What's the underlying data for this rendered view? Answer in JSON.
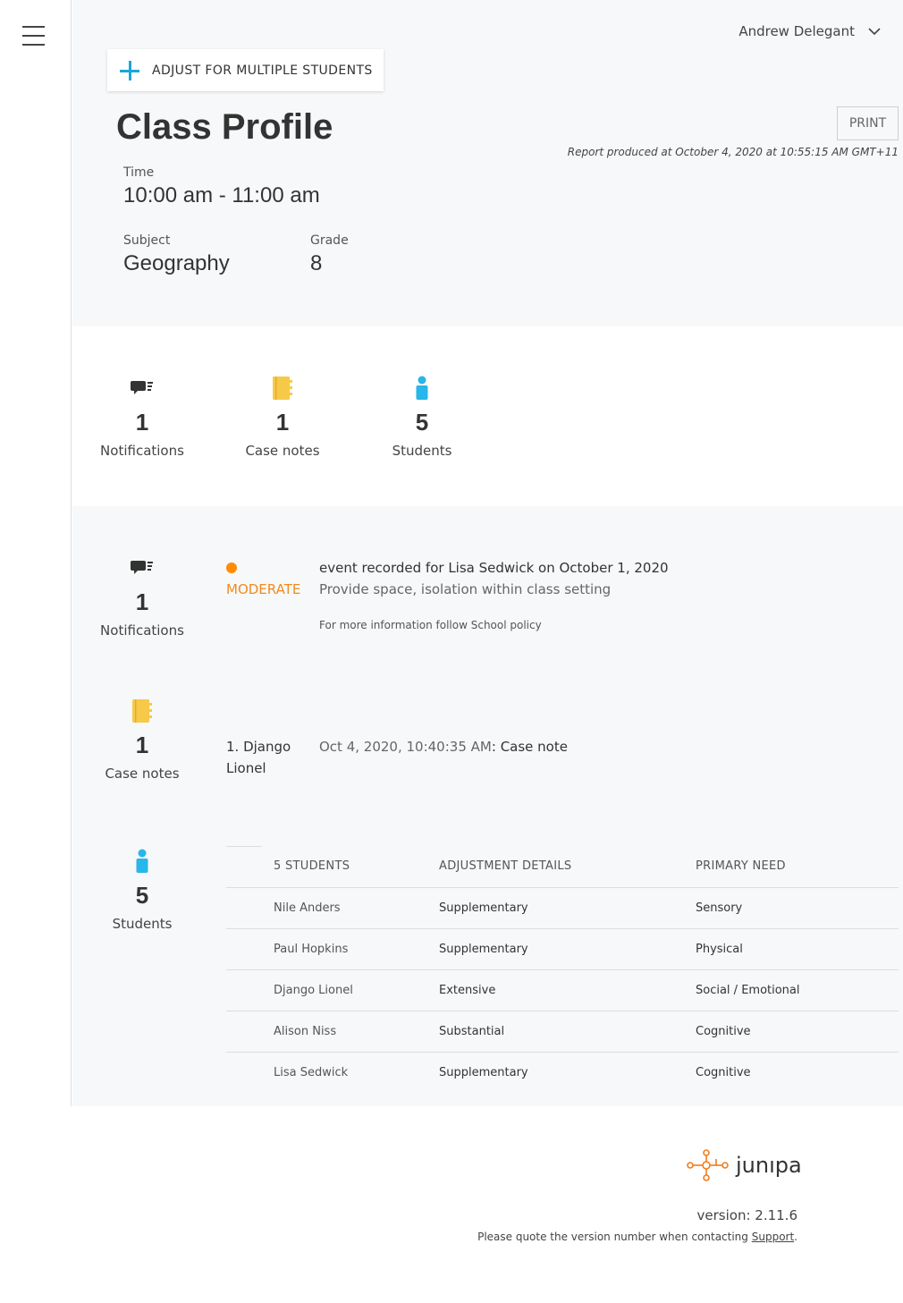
{
  "user": {
    "name": "Andrew Delegant"
  },
  "actions": {
    "adjust_label": "ADJUST FOR MULTIPLE STUDENTS",
    "print_label": "PRINT"
  },
  "page": {
    "title": "Class Profile",
    "report_time": "Report produced at October 4, 2020 at 10:55:15 AM GMT+11"
  },
  "class_info": {
    "time_label": "Time",
    "time_value": "10:00 am - 11:00 am",
    "subject_label": "Subject",
    "subject_value": "Geography",
    "grade_label": "Grade",
    "grade_value": "8"
  },
  "summary": {
    "notifications": {
      "count": "1",
      "label": "Notifications"
    },
    "case_notes": {
      "count": "1",
      "label": "Case notes"
    },
    "students": {
      "count": "5",
      "label": "Students"
    }
  },
  "notifications_detail": {
    "count": "1",
    "label": "Notifications",
    "severity": "MODERATE",
    "event": "event recorded for Lisa Sedwick on October 1, 2020",
    "action": "Provide space, isolation within class setting",
    "info": "For more information follow School policy"
  },
  "case_notes_detail": {
    "count": "1",
    "label": "Case notes",
    "student_line1": "1. Django",
    "student_line2": "Lionel",
    "date": "Oct 4, 2020, 10:40:35 AM",
    "separator": ":",
    "note": "Case note"
  },
  "students_detail": {
    "count": "5",
    "label": "Students",
    "headers": [
      "5 STUDENTS",
      "ADJUSTMENT DETAILS",
      "PRIMARY NEED"
    ],
    "rows": [
      {
        "name": "Nile Anders",
        "adjustment": "Supplementary",
        "need": "Sensory"
      },
      {
        "name": "Paul Hopkins",
        "adjustment": "Supplementary",
        "need": "Physical"
      },
      {
        "name": "Django Lionel",
        "adjustment": "Extensive",
        "need": "Social / Emotional"
      },
      {
        "name": "Alison Niss",
        "adjustment": "Substantial",
        "need": "Cognitive"
      },
      {
        "name": "Lisa Sedwick",
        "adjustment": "Supplementary",
        "need": "Cognitive"
      }
    ]
  },
  "footer": {
    "logo_text": "junıpa",
    "version": "version: 2.11.6",
    "quote_prefix": "Please quote the version number when contacting ",
    "support_link": "Support",
    "quote_suffix": "."
  },
  "colors": {
    "accent_blue": "#1aa7d8",
    "student_icon": "#29b6e8",
    "case_note_icon": "#f7c948",
    "moderate": "#f28a1e",
    "logo_orange": "#f07d1e"
  },
  "icons": {
    "menu": "hamburger-icon",
    "notification": "chat-bubble-icon",
    "case_note": "notebook-icon",
    "student": "person-icon",
    "user_dropdown": "chevron-down-icon"
  }
}
